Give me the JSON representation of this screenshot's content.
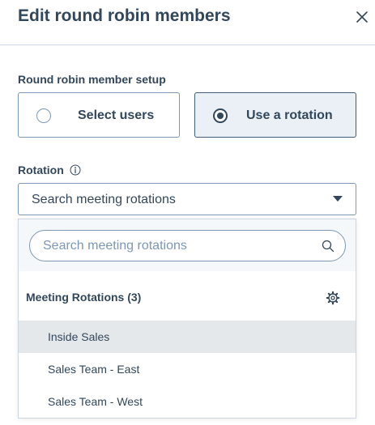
{
  "header": {
    "title": "Edit round robin members"
  },
  "member_setup": {
    "label": "Round robin member setup",
    "options": [
      {
        "label": "Select users",
        "selected": false
      },
      {
        "label": "Use a rotation",
        "selected": true
      }
    ]
  },
  "rotation": {
    "label": "Rotation",
    "select_text": "Search meeting rotations",
    "dropdown": {
      "search_placeholder": "Search meeting rotations",
      "group_header": "Meeting Rotations (3)",
      "items": [
        {
          "label": "Inside Sales",
          "highlighted": true
        },
        {
          "label": "Sales Team - East",
          "highlighted": false
        },
        {
          "label": "Sales Team - West",
          "highlighted": false
        }
      ]
    }
  },
  "colors": {
    "text": "#33475b",
    "border": "#7c98b6",
    "selected_card_bg": "#eaf0f6",
    "search_area_bg": "#f5f8fa",
    "highlight_bg": "#e5e8eb"
  },
  "icons": [
    "close-icon",
    "info-icon",
    "caret-down-icon",
    "search-icon",
    "gear-icon"
  ]
}
